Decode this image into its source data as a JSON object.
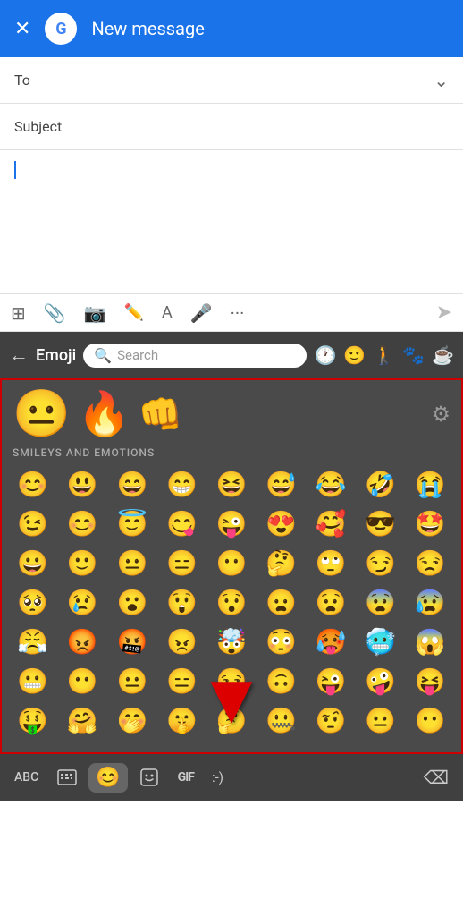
{
  "header": {
    "title": "New message",
    "close_icon": "×",
    "google_letter": "G"
  },
  "compose": {
    "to_label": "To",
    "subject_label": "Subject",
    "to_placeholder": "",
    "subject_placeholder": ""
  },
  "toolbar": {
    "icons": [
      "add-attachment",
      "paperclip",
      "camera",
      "pen",
      "font",
      "mic",
      "more"
    ],
    "send_label": "Send"
  },
  "emoji_keyboard": {
    "back_label": "←",
    "title": "Emoji",
    "search_placeholder": "Search",
    "nav_icons": [
      "clock",
      "smiley",
      "person",
      "activity",
      "coffee"
    ],
    "category_label": "SMILEYS AND EMOTIONS",
    "featured": [
      "😐",
      "🔥👊"
    ],
    "emojis_row1": [
      "😊",
      "😃",
      "😄",
      "😁",
      "😆",
      "😅",
      "😂",
      "🤣",
      "😭"
    ],
    "emojis_row2": [
      "😉",
      "😊",
      "😇",
      "😋",
      "😜",
      "😍",
      "🥰",
      "😎",
      "🤩"
    ],
    "emojis_row3": [
      "😀",
      "🙂",
      "😐",
      "😑",
      "😶",
      "🤔",
      "🙄",
      "😏",
      "😒"
    ],
    "emojis_row4": [
      "🥺",
      "😢",
      "😮",
      "😲",
      "😯",
      "😦",
      "😧",
      "😨",
      "😰"
    ],
    "emojis_row5": [
      "😤",
      "😡",
      "🤬",
      "😠",
      "🤯",
      "😳",
      "🥵",
      "🥶",
      "😱"
    ],
    "emojis_row6": [
      "😬",
      "😶",
      "😐",
      "😑",
      "😏",
      "🙃",
      "😜",
      "🤪",
      "😝"
    ],
    "emojis_row7": [
      "🤑",
      "🤗",
      "🤭",
      "🤫",
      "🤔",
      "🤐",
      "🤨",
      "😐",
      "😶"
    ]
  },
  "keyboard_bottom": {
    "abc_label": "ABC",
    "icons": [
      "keyboard-switch",
      "emoji",
      "sticker",
      "gif",
      "smiley-text",
      "backspace"
    ]
  },
  "colors": {
    "header_bg": "#1a73e8",
    "emoji_bg": "#4a4a4a",
    "emoji_header_bg": "#404040",
    "border_red": "#cc0000"
  }
}
